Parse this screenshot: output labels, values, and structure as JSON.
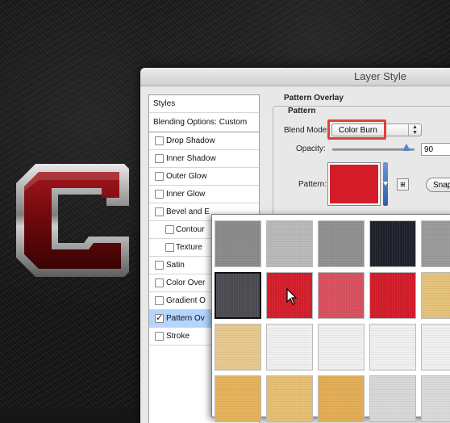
{
  "dialog": {
    "title": "Layer Style",
    "section_title": "Pattern Overlay",
    "group_title": "Pattern",
    "blend_mode_label": "Blend Mode:",
    "blend_mode_value": "Color Burn",
    "opacity_label": "Opacity:",
    "opacity_value": "90",
    "opacity_level": 0.9,
    "pattern_label": "Pattern:",
    "pattern_color": "#d51d2a",
    "snap_button": "Snap",
    "new_preset_icon": "new-preset-icon"
  },
  "styles_list": {
    "header": "Styles",
    "blending": "Blending Options: Custom",
    "items": [
      {
        "label": "Drop Shadow",
        "checked": false,
        "sub": false,
        "selected": false
      },
      {
        "label": "Inner Shadow",
        "checked": false,
        "sub": false,
        "selected": false
      },
      {
        "label": "Outer Glow",
        "checked": false,
        "sub": false,
        "selected": false
      },
      {
        "label": "Inner Glow",
        "checked": false,
        "sub": false,
        "selected": false
      },
      {
        "label": "Bevel and E",
        "checked": false,
        "sub": false,
        "selected": false
      },
      {
        "label": "Contour",
        "checked": false,
        "sub": true,
        "selected": false
      },
      {
        "label": "Texture",
        "checked": false,
        "sub": true,
        "selected": false
      },
      {
        "label": "Satin",
        "checked": false,
        "sub": false,
        "selected": false
      },
      {
        "label": "Color Over",
        "checked": false,
        "sub": false,
        "selected": false
      },
      {
        "label": "Gradient O",
        "checked": false,
        "sub": false,
        "selected": false
      },
      {
        "label": "Pattern Ov",
        "checked": true,
        "sub": false,
        "selected": true
      },
      {
        "label": "Stroke",
        "checked": false,
        "sub": false,
        "selected": false
      }
    ]
  },
  "pattern_picker": {
    "selected_index": 5,
    "tiles": [
      "#8a8a8a",
      "#b9b9b9",
      "#8f8f8f",
      "#1e212a",
      "#9a9a9a",
      "#4b4c52",
      "#d51d2a",
      "#d9505e",
      "#d41b29",
      "#e6c278",
      "#e8c88c",
      "#f0f0f0",
      "#f0f0f0",
      "#f0f0f0",
      "#f0f0f0",
      "#e6b25a",
      "#e8bf71",
      "#e3ad55",
      "#d8d8d8",
      "#dadada"
    ]
  },
  "colors": {
    "highlight": "#e0413a",
    "selection": "#b5d5ff",
    "logo_red": "#8b0c12"
  }
}
